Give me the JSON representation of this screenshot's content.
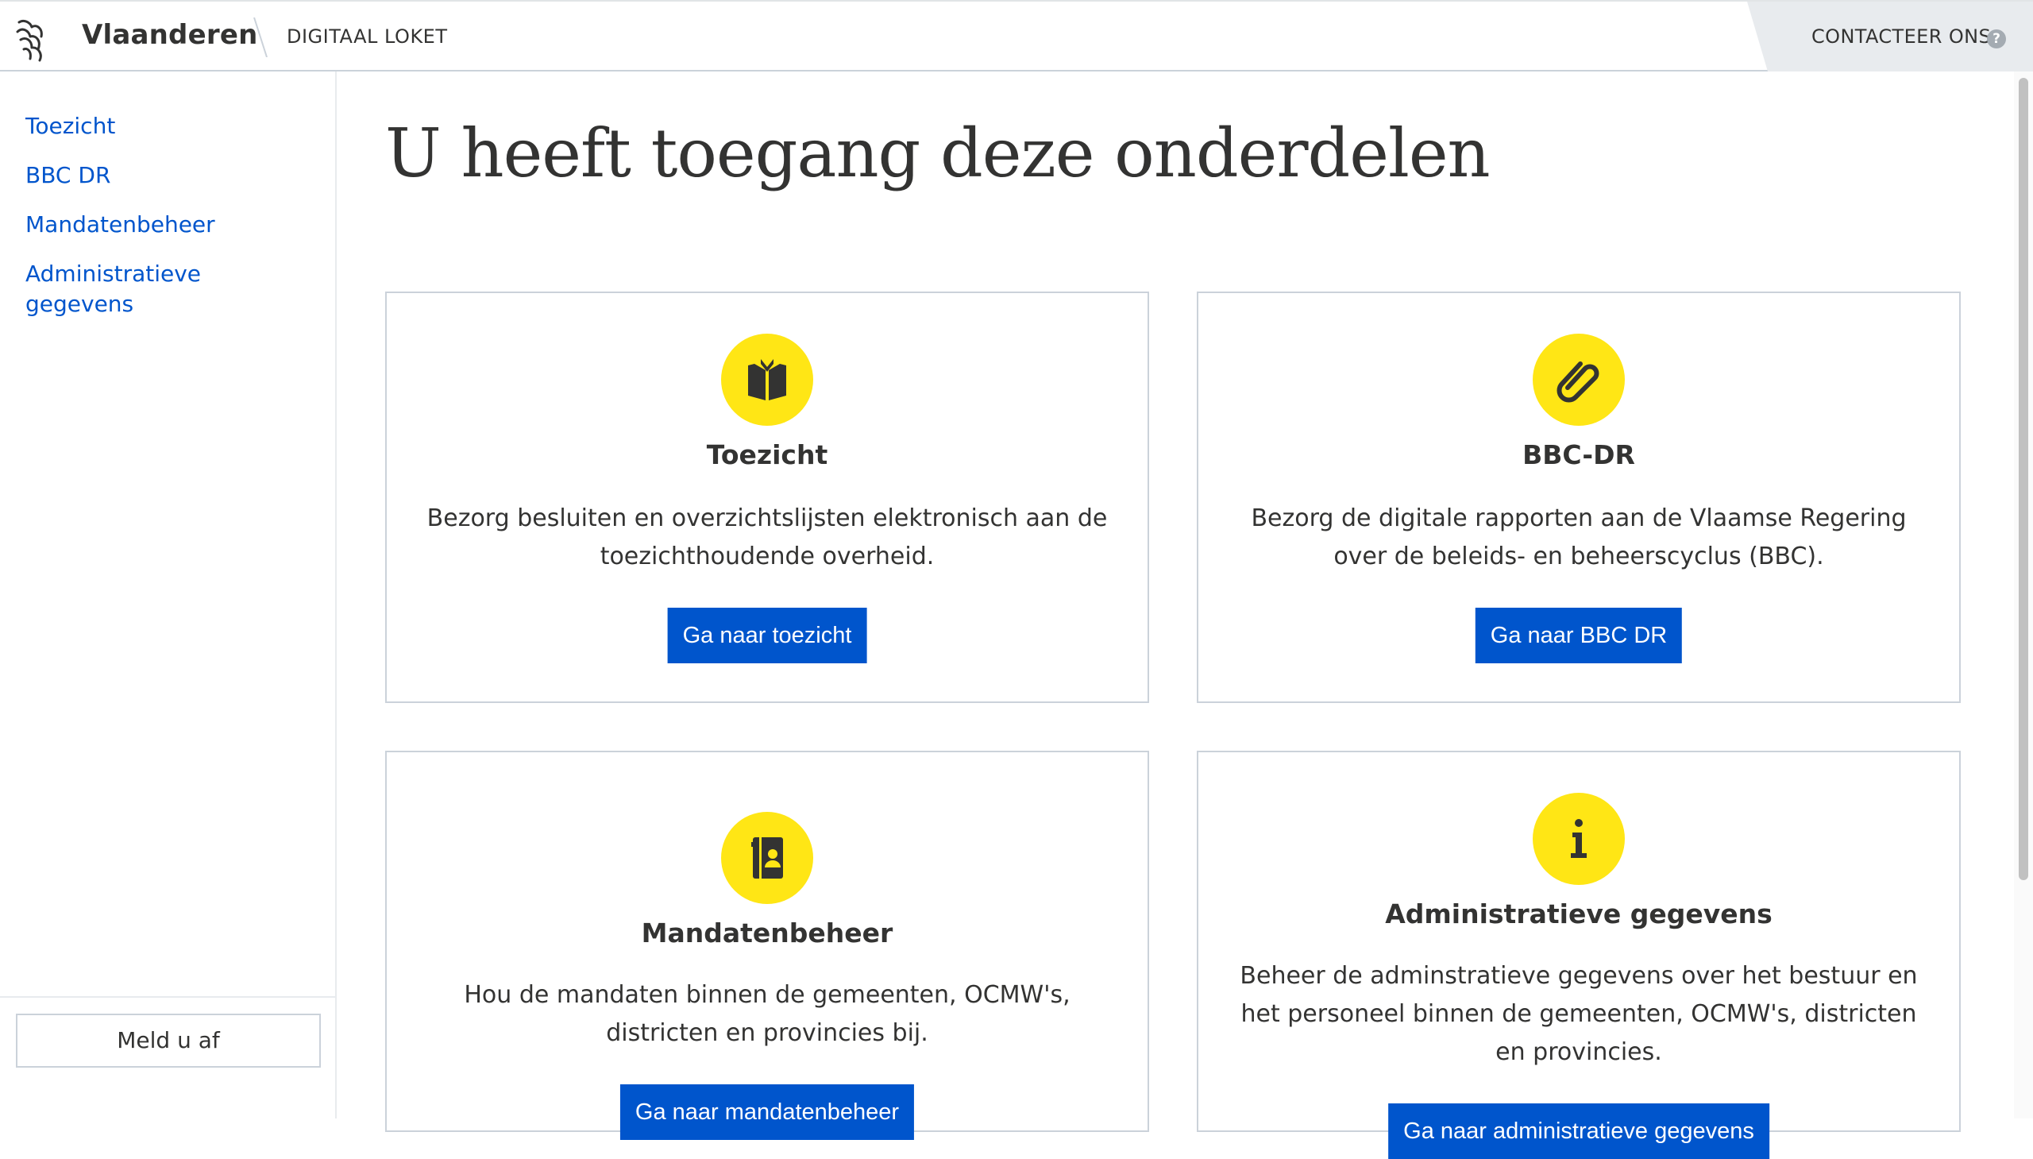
{
  "header": {
    "brand": "Vlaanderen",
    "subbrand": "DIGITAAL LOKET",
    "contact_label": "CONTACTEER ONS",
    "help_glyph": "?",
    "logo_icon": "flemish-lion-icon"
  },
  "sidebar": {
    "items": [
      {
        "label": "Toezicht"
      },
      {
        "label": "BBC DR"
      },
      {
        "label": "Mandatenbeheer"
      },
      {
        "label": "Administratieve gegevens"
      }
    ],
    "logout_label": "Meld u af"
  },
  "main": {
    "title": "U heeft toegang deze onderdelen",
    "cards": [
      {
        "icon": "book-icon",
        "title": "Toezicht",
        "description": "Bezorg besluiten en overzichtslijsten elektronisch aan de toezichthoudende overheid.",
        "button": "Ga naar toezicht"
      },
      {
        "icon": "paperclip-icon",
        "title": "BBC-DR",
        "description": "Bezorg de digitale rapporten aan de Vlaamse Regering over de beleids- en beheerscyclus (BBC).",
        "button": "Ga naar BBC DR"
      },
      {
        "icon": "contact-book-icon",
        "title": "Mandatenbeheer",
        "description": "Hou de mandaten binnen de gemeenten, OCMW's, districten en provincies bij.",
        "button": "Ga naar mandatenbeheer"
      },
      {
        "icon": "info-icon",
        "title": "Administratieve gegevens",
        "description": "Beheer de adminstratieve gegevens over het bestuur en het personeel binnen de gemeenten, OCMW's, districten en provincies.",
        "button": "Ga naar administratieve gegevens"
      }
    ]
  },
  "colors": {
    "accent_blue": "#0055cc",
    "icon_yellow": "#ffe615",
    "border_grey": "#cbd2da",
    "text_dark": "#333332"
  }
}
